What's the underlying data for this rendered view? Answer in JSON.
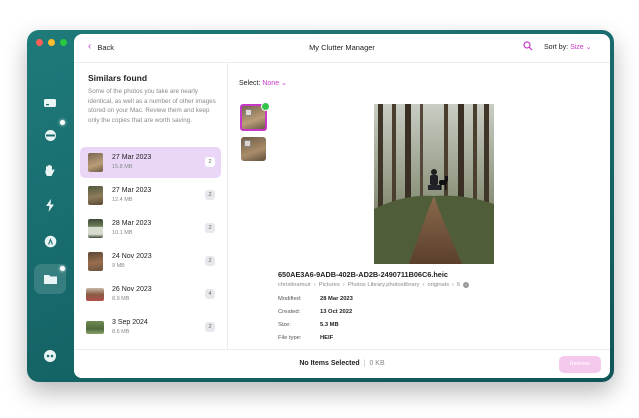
{
  "app": {
    "title": "My Clutter Manager",
    "back_label": "Back",
    "sort_label": "Sort by:",
    "sort_value": "Size"
  },
  "sidebar": {
    "items": [
      {
        "icon": "drive-icon"
      },
      {
        "icon": "disk-cleanup-icon"
      },
      {
        "icon": "hand-privacy-icon"
      },
      {
        "icon": "lightning-speed-icon"
      },
      {
        "icon": "applications-icon"
      },
      {
        "icon": "folder-files-icon",
        "active": true
      }
    ],
    "bottom_icon": "assistant-icon"
  },
  "similars": {
    "title": "Similars found",
    "description": "Some of the photos you take are nearly identical, as well as a number of other images stored on your Mac. Review them and keep only the copies that are worth saving.",
    "groups": [
      {
        "date": "27 Mar 2023",
        "size": "15.8 MB",
        "count": "2",
        "selected": true
      },
      {
        "date": "27 Mar 2023",
        "size": "12.4 MB",
        "count": "2"
      },
      {
        "date": "28 Mar 2023",
        "size": "10.1 MB",
        "count": "2"
      },
      {
        "date": "24 Nov 2023",
        "size": "9 MB",
        "count": "2"
      },
      {
        "date": "26 Nov 2023",
        "size": "8.9 MB",
        "count": "4"
      },
      {
        "date": "3 Sep 2024",
        "size": "8.6 MB",
        "count": "2"
      }
    ]
  },
  "detail": {
    "select_label": "Select:",
    "select_value": "None",
    "filename": "650AE3A6-9ADB-402B-AD2B-2490711B06C6.heic",
    "path": [
      "christinamuir",
      "Pictures",
      "Photos Library.photoslibrary",
      "originals",
      "6"
    ],
    "fields": [
      {
        "key": "Modified:",
        "value": "28 Mar 2023"
      },
      {
        "key": "Created:",
        "value": "13 Oct 2022"
      },
      {
        "key": "Size:",
        "value": "5.3 MB"
      },
      {
        "key": "File type:",
        "value": "HEIF"
      }
    ]
  },
  "footer": {
    "status": "No Items Selected",
    "size": "0 KB",
    "action_label": "Remove"
  },
  "colors": {
    "accent": "#c838c8",
    "sidebar": "#176a6c",
    "selected_row": "#ead7f7"
  }
}
